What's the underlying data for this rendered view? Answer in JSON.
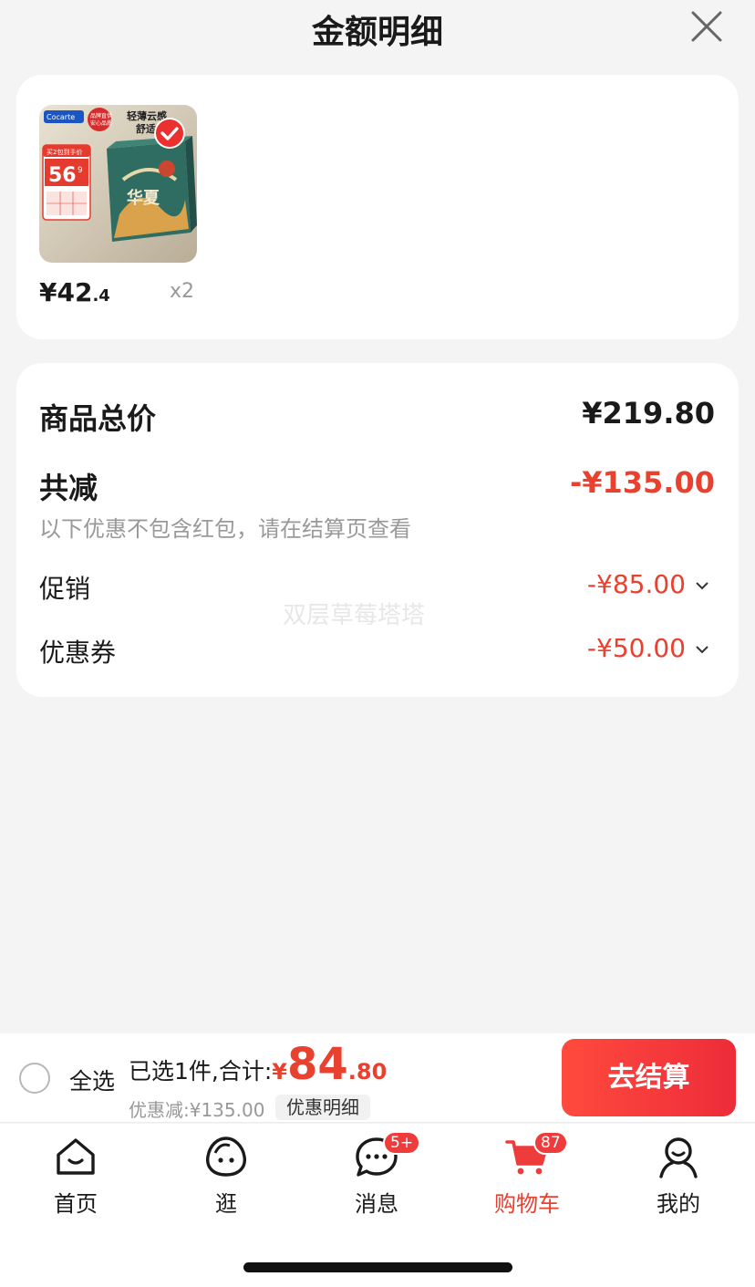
{
  "header": {
    "title": "金额明细"
  },
  "product": {
    "image_texts": {
      "brand": "Cocarte",
      "badge_line1": "品牌直供",
      "badge_line2": "安心品质",
      "slogan_line1": "轻薄云感",
      "slogan_line2": "舒适",
      "promo_title": "买2包到手价",
      "promo_price": "56",
      "promo_decimal": "9",
      "box_title": "华夏"
    },
    "price_int": "¥42",
    "price_dec": ".4",
    "quantity": "x2"
  },
  "summary": {
    "total_label": "商品总价",
    "total_value": "¥219.80",
    "reduce_label": "共减",
    "reduce_value": "-¥135.00",
    "note": "以下优惠不包含红包，请在结算页查看",
    "promo_label": "促销",
    "promo_value": "-¥85.00",
    "coupon_label": "优惠券",
    "coupon_value": "-¥50.00",
    "watermark": "双层草莓塔塔"
  },
  "checkout": {
    "select_all": "全选",
    "selected_label": "已选1件,合计:",
    "total_symbol": "¥",
    "total_int": "84",
    "total_dec": ".80",
    "discount_text": "优惠减:¥135.00",
    "detail_button": "优惠明细",
    "checkout_button": "去结算"
  },
  "tabs": [
    {
      "label": "首页",
      "icon": "home-icon"
    },
    {
      "label": "逛",
      "icon": "browse-face-icon"
    },
    {
      "label": "消息",
      "icon": "message-icon",
      "badge": "5+"
    },
    {
      "label": "购物车",
      "icon": "cart-icon",
      "badge": "87",
      "active": true
    },
    {
      "label": "我的",
      "icon": "profile-icon"
    }
  ],
  "colors": {
    "accent_red": "#e8412f",
    "background": "#f4f4f4",
    "card": "#ffffff"
  }
}
